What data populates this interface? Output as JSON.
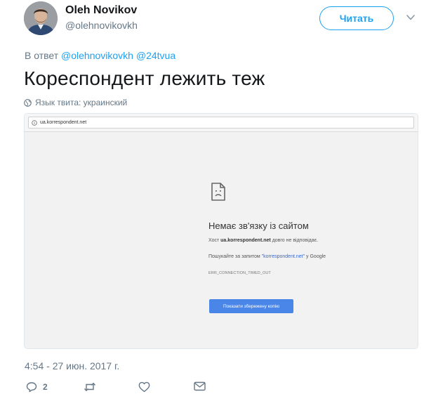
{
  "author": {
    "name": "Oleh Novikov",
    "handle": "@olehnovikovkh"
  },
  "follow_button": {
    "label": "Читать"
  },
  "reply_to": {
    "prefix": "В ответ",
    "mentions": [
      "@olehnovikovkh",
      "@24tvua"
    ]
  },
  "tweet": {
    "text": "Кореспондент лежить теж",
    "language_line": "Язык твита: украинский"
  },
  "media": {
    "address": "ua.korrespondent.net",
    "error_title": "Немає зв'язку із сайтом",
    "host_prefix": "Хост",
    "host": "ua.korrespondent.net",
    "host_suffix": "довго не відповідає.",
    "search_prefix": "Пошукайте за запитом",
    "search_query": "\"korrespondent.net\"",
    "search_suffix": "у Google",
    "error_code": "ERR_CONNECTION_TIMED_OUT",
    "button_label": "Показати збережену копію"
  },
  "timestamp": "4:54 - 27 июн. 2017 г.",
  "actions": {
    "reply_count": "2"
  },
  "colors": {
    "accent": "#1da1f2",
    "muted": "#657786",
    "chrome_button": "#4a86e8"
  }
}
